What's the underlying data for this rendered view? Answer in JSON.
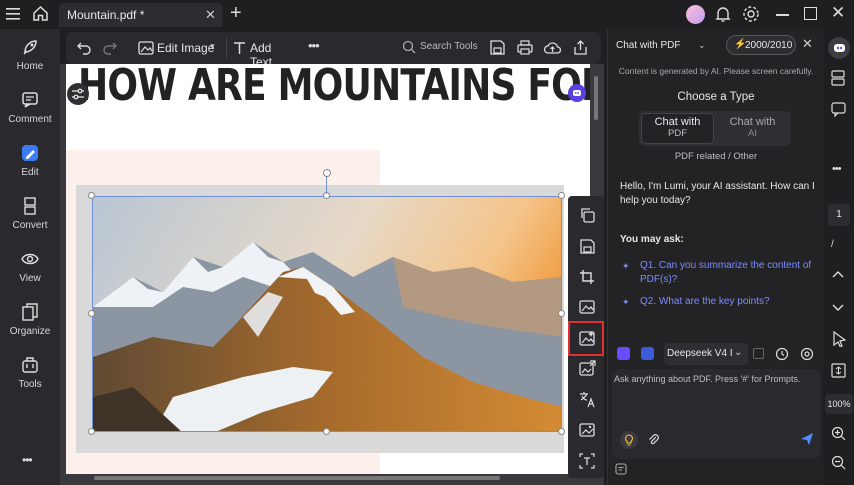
{
  "titlebar": {
    "tab_title": "Mountain.pdf *"
  },
  "leftnav": {
    "items": [
      {
        "label": "Home",
        "icon": "rocket-icon"
      },
      {
        "label": "Comment",
        "icon": "comment-icon"
      },
      {
        "label": "Edit",
        "icon": "edit-icon"
      },
      {
        "label": "Convert",
        "icon": "convert-icon"
      },
      {
        "label": "View",
        "icon": "view-icon"
      },
      {
        "label": "Organize",
        "icon": "organize-icon"
      },
      {
        "label": "Tools",
        "icon": "tools-icon"
      }
    ],
    "more": "•••"
  },
  "toolbar": {
    "edit_image": "Edit Image",
    "add_text": "Add Text",
    "search_tools": "Search Tools"
  },
  "document": {
    "heading": "HOW ARE MOUNTAINS FORMED?"
  },
  "chat": {
    "mode": "Chat with PDF",
    "credits": "2000/2010",
    "disclaimer": "Content is generated by AI. Please screen carefully.",
    "choose_type": "Choose a Type",
    "option1_line1": "Chat with",
    "option1_line2": "PDF",
    "option2_line1": "Chat with",
    "option2_line2": "AI",
    "related": "PDF related / Other",
    "greeting": "Hello, I'm Lumi, your AI assistant. How can I help you today?",
    "you_may_ask": "You may ask:",
    "q1": "Q1. Can you summarize the content of PDF(s)?",
    "q2": "Q2. What are the key points?",
    "model": "Deepseek V4 I",
    "input_placeholder": "Ask anything about PDF. Press '#' for Prompts."
  },
  "rightrail": {
    "page": "1",
    "zoom": "100%"
  },
  "colors": {
    "accent": "#7b8cff",
    "highlight_box": "#e03131",
    "ai_purple": "#6c4cff"
  }
}
